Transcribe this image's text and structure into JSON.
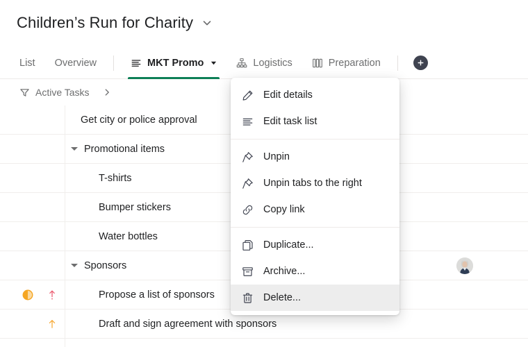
{
  "theme": {
    "accent": "#0d7f56",
    "dark": "#3f4350",
    "text": "#1e1f21",
    "muted": "#6d6e6f",
    "border": "#edeae9",
    "hover_bg": "#ededed",
    "priority_high": "#eb5a6f",
    "priority_medium": "#f6a935",
    "status_orange": "#f5a623"
  },
  "header": {
    "project_title": "Children’s Run for Charity",
    "title_chevron_icon": "chevron-down-icon"
  },
  "tabs": [
    {
      "label": "List",
      "icon": null,
      "active": false,
      "caret": false
    },
    {
      "label": "Overview",
      "icon": null,
      "active": false,
      "caret": false
    },
    {
      "label": "MKT Promo",
      "icon": "task-list-icon",
      "active": true,
      "caret": true
    },
    {
      "label": "Logistics",
      "icon": "org-chart-icon",
      "active": false,
      "caret": false
    },
    {
      "label": "Preparation",
      "icon": "board-icon",
      "active": false,
      "caret": false
    }
  ],
  "add_tab": {
    "icon": "plus-icon",
    "label": ""
  },
  "filter": {
    "icon": "filter-icon",
    "label": "Active Tasks",
    "next_icon": "chevron-right-icon"
  },
  "rows": [
    {
      "name": "Get city or police approval",
      "indent": 1,
      "expander": false,
      "status": null,
      "priority": null,
      "assignee": null
    },
    {
      "name": "Promotional items",
      "indent": 0,
      "expander": true,
      "status": null,
      "priority": null,
      "assignee": null
    },
    {
      "name": "T-shirts",
      "indent": 2,
      "expander": false,
      "status": null,
      "priority": null,
      "assignee": null
    },
    {
      "name": "Bumper stickers",
      "indent": 2,
      "expander": false,
      "status": null,
      "priority": null,
      "assignee": null
    },
    {
      "name": "Water bottles",
      "indent": 2,
      "expander": false,
      "status": null,
      "priority": null,
      "assignee": null
    },
    {
      "name": "Sponsors",
      "indent": 0,
      "expander": true,
      "status": null,
      "priority": null,
      "assignee": "avatar-photo"
    },
    {
      "name": "Propose a list of sponsors",
      "indent": 2,
      "expander": false,
      "status": "half-circle-icon",
      "priority": "arrow-up-high-icon",
      "assignee": null
    },
    {
      "name": "Draft and sign agreement with sponsors",
      "indent": 2,
      "expander": false,
      "status": null,
      "priority": "arrow-up-medium-icon",
      "assignee": null
    }
  ],
  "menu": {
    "groups": [
      [
        {
          "label": "Edit details",
          "icon": "pencil-icon",
          "hovered": false
        },
        {
          "label": "Edit task list",
          "icon": "task-list-icon",
          "hovered": false
        }
      ],
      [
        {
          "label": "Unpin",
          "icon": "pin-icon",
          "hovered": false
        },
        {
          "label": "Unpin tabs to the right",
          "icon": "pin-icon",
          "hovered": false
        },
        {
          "label": "Copy link",
          "icon": "link-icon",
          "hovered": false
        }
      ],
      [
        {
          "label": "Duplicate...",
          "icon": "duplicate-icon",
          "hovered": false
        },
        {
          "label": "Archive...",
          "icon": "archive-icon",
          "hovered": false
        },
        {
          "label": "Delete...",
          "icon": "trash-icon",
          "hovered": true
        }
      ]
    ]
  }
}
